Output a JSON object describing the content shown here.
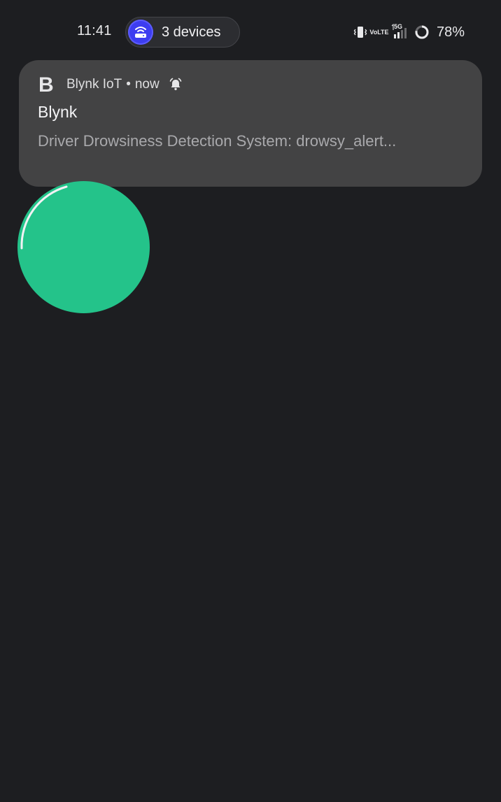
{
  "status_bar": {
    "time": "11:41",
    "hotspot": {
      "label": "3 devices",
      "icon": "hotspot-router-icon",
      "accent": "#3d3df0"
    },
    "icons": [
      "vibrate-icon",
      "volte-icon",
      "signal-5g-icon",
      "battery-ring-icon"
    ],
    "volte_top": "Vo",
    "volte_bottom": "LTE",
    "network": "5G",
    "battery": "78%"
  },
  "notification": {
    "logo": "B",
    "app": "Blynk IoT",
    "separator": "•",
    "time": "now",
    "alert_icon": "alarm-bell-icon",
    "title": "Blynk",
    "body": "Driver Drowsiness Detection System: drowsy_alert..."
  },
  "overlay": {
    "bubble_color": "#24c38a"
  }
}
